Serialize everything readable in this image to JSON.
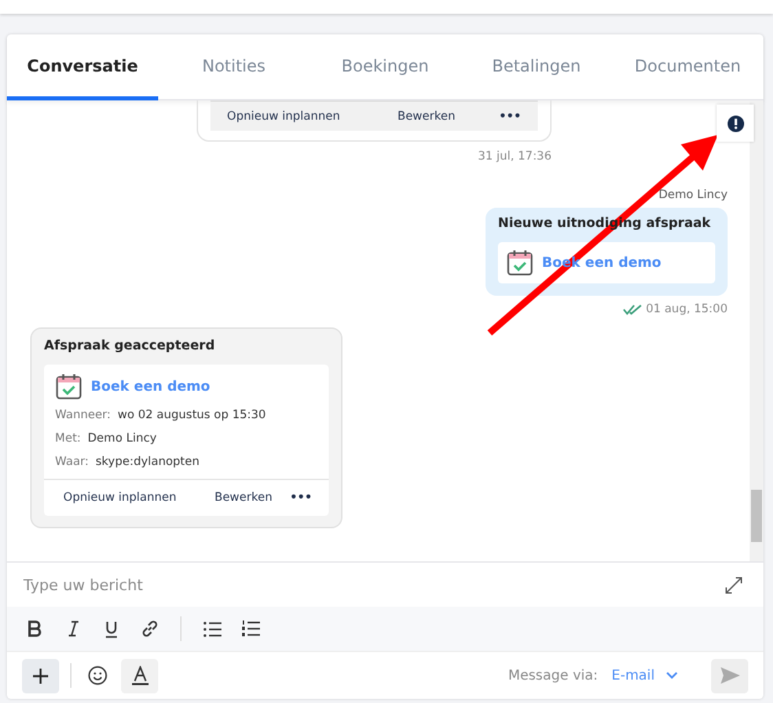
{
  "tabs": [
    {
      "label": "Conversatie",
      "selected": true
    },
    {
      "label": "Notities",
      "selected": false
    },
    {
      "label": "Boekingen",
      "selected": false
    },
    {
      "label": "Betalingen",
      "selected": false
    },
    {
      "label": "Documenten",
      "selected": false
    }
  ],
  "messages": [
    {
      "kind": "partial",
      "actions": [
        "Opnieuw inplannen",
        "Bewerken",
        "•••"
      ],
      "time": "31 jul, 17:36"
    },
    {
      "kind": "invite",
      "sender": "Demo Lincy",
      "title": "Nieuwe uitnodiging afspraak",
      "link": "Boek een demo",
      "time": "01 aug, 15:00",
      "read": true
    },
    {
      "kind": "accepted",
      "title": "Afspraak geaccepteerd",
      "link": "Boek een demo",
      "details": [
        {
          "label": "Wanneer:",
          "value": "wo 02 augustus op 15:30"
        },
        {
          "label": "Met:",
          "value": "Demo Lincy"
        },
        {
          "label": "Waar:",
          "value": "skype:dylanopten"
        }
      ],
      "actions": [
        "Opnieuw inplannen",
        "Bewerken",
        "•••"
      ]
    }
  ],
  "composer": {
    "placeholder": "Type uw bericht",
    "channel_label": "Message via:",
    "channel": "E-mail"
  }
}
